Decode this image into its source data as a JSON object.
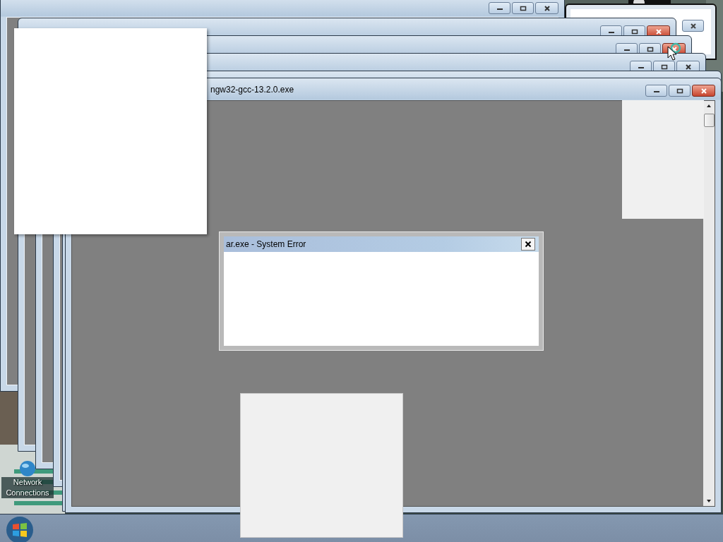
{
  "desktop": {
    "icons": [
      {
        "label": "Network Connections"
      }
    ]
  },
  "windows": [
    {
      "kind": "frame",
      "close_highlighted": false
    },
    {
      "kind": "tool",
      "close_highlighted": false
    },
    {
      "kind": "frame",
      "close_highlighted": true
    },
    {
      "kind": "frame",
      "close_highlighted": true
    },
    {
      "kind": "frame",
      "close_highlighted": false
    },
    {
      "kind": "strip"
    }
  ],
  "main_window": {
    "title": "ngw32-gcc-13.2.0.exe",
    "close_highlighted": true
  },
  "error_dialog": {
    "title": "ar.exe - System Error"
  }
}
